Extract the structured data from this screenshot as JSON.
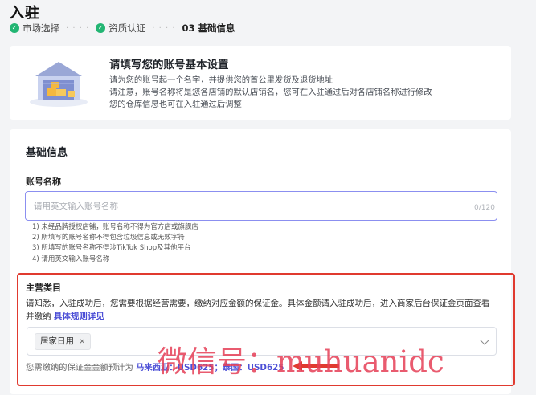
{
  "page": {
    "title": "入驻"
  },
  "steps": [
    {
      "label": "市场选择",
      "status": "done"
    },
    {
      "label": "资质认证",
      "status": "done"
    },
    {
      "label": "03 基础信息",
      "status": "current"
    }
  ],
  "intro": {
    "title": "请填写您的账号基本设置",
    "lines": [
      "请为您的账号起一个名字，并提供您的首公里发货及退货地址",
      "请注意，账号名称将是您各店铺的默认店铺名，您可在入驻通过后对各店铺名称进行修改",
      "您的仓库信息也可在入驻通过后调整"
    ],
    "illustration": "warehouse-illustration"
  },
  "basic": {
    "section_title": "基础信息",
    "account_name": {
      "label": "账号名称",
      "placeholder": "请用英文输入账号名称",
      "value": "",
      "counter": "0/120"
    },
    "rules": [
      "1) 未经品牌授权店铺，账号名称不得为官方店或旗舰店",
      "2) 所填写的账号名称不得包含垃圾信息或无效字符",
      "3) 所填写的账号名称不得涉TikTok Shop及其他平台",
      "4) 请用英文输入账号名称"
    ]
  },
  "category": {
    "label": "主营类目",
    "desc_line1": "请知悉，入驻成功后，您需要根据经营需要，缴纳对应金额的保证金。具体金额请入驻成功后，进入商家后台保证金页面查看",
    "desc_line2_prefix": "并缴纳",
    "rule_link": "具体规则详见",
    "selected_tag": "居家日用",
    "tag_close": "×",
    "deposit_prefix": "您需缴纳的保证金金额预计为",
    "deposit_amount": "马来西亚：USD625；泰国：USD625"
  },
  "annotation": {
    "watermark": "微信号：muhuanidc",
    "highlight_color": "#e03a2f",
    "arrow_color": "#e03a2f"
  },
  "colors": {
    "accent": "#4c4fd6",
    "success": "#22b573",
    "input_focus_border": "#8b8ff0"
  }
}
